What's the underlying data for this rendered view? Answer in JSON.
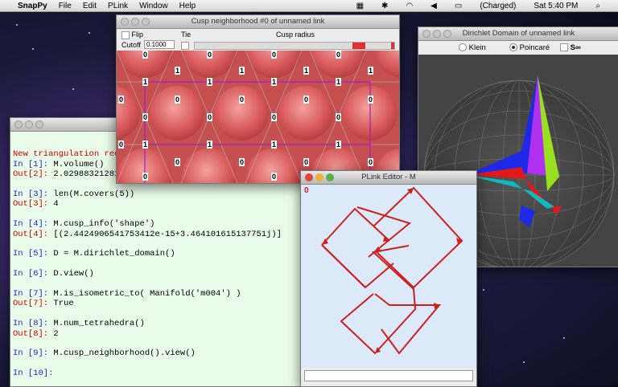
{
  "menubar": {
    "app": "SnapPy",
    "items": [
      "File",
      "Edit",
      "PLink",
      "Window",
      "Help"
    ],
    "battery": "(Charged)",
    "clock": "Sat 5:40 PM"
  },
  "console": {
    "banner": "New triangulation rece",
    "lines": [
      {
        "in": "In [1]:",
        "code": " M.volume()"
      },
      {
        "out": "Out[2]:",
        "result": " 2.0298832128193"
      },
      {
        "in": "In [3]:",
        "code": " len(M.covers(5))"
      },
      {
        "out": "Out[3]:",
        "result": " 4"
      },
      {
        "in": "In [4]:",
        "code": " M.cusp_info('shape')"
      },
      {
        "out": "Out[4]:",
        "result": " [(2.4424906541753412e-15+3.464101615137751j)]"
      },
      {
        "in": "In [5]:",
        "code": " D = M.dirichlet_domain()"
      },
      {
        "in": "In [6]:",
        "code": " D.view()"
      },
      {
        "in": "In [7]:",
        "code": " M.is_isometric_to( Manifold('m004') )"
      },
      {
        "out": "Out[7]:",
        "result": " True"
      },
      {
        "in": "In [8]:",
        "code": " M.num_tetrahedra()"
      },
      {
        "out": "Out[8]:",
        "result": " 2"
      },
      {
        "in": "In [9]:",
        "code": " M.cusp_neighborhood().view()"
      },
      {
        "in": "In [10]:",
        "code": ""
      }
    ]
  },
  "cusp_window": {
    "title": "Cusp neighborhood #0 of unnamed link",
    "flip_label": "Flip",
    "tie_label": "Tie",
    "cusp_radius_label": "Cusp radius",
    "cutoff_label": "Cutoff",
    "cutoff_value": "0.1000",
    "labels_row_top": [
      "0",
      "0",
      "0",
      "0",
      "0",
      "0",
      "0",
      "0",
      "0",
      "0"
    ],
    "labels_row_one": [
      "1",
      "1",
      "1",
      "1",
      "1",
      "1",
      "1",
      "1"
    ],
    "labels_mid": [
      "0",
      "0",
      "0",
      "0",
      "0",
      "0",
      "0",
      "0",
      "0",
      "0"
    ]
  },
  "dirichlet_window": {
    "title": "Dirichlet Domain of unnamed link",
    "options": [
      "Klein",
      "Poincaré",
      "S∞"
    ],
    "selected": "Poincaré",
    "colors": {
      "blue": "#1e28e8",
      "magenta": "#b030f0",
      "green": "#98e020",
      "red": "#e01818",
      "cyan": "#10b8c0"
    }
  },
  "plink_window": {
    "title": "PLink Editor - M",
    "component_label": "0",
    "link_color": "#cc2020"
  }
}
